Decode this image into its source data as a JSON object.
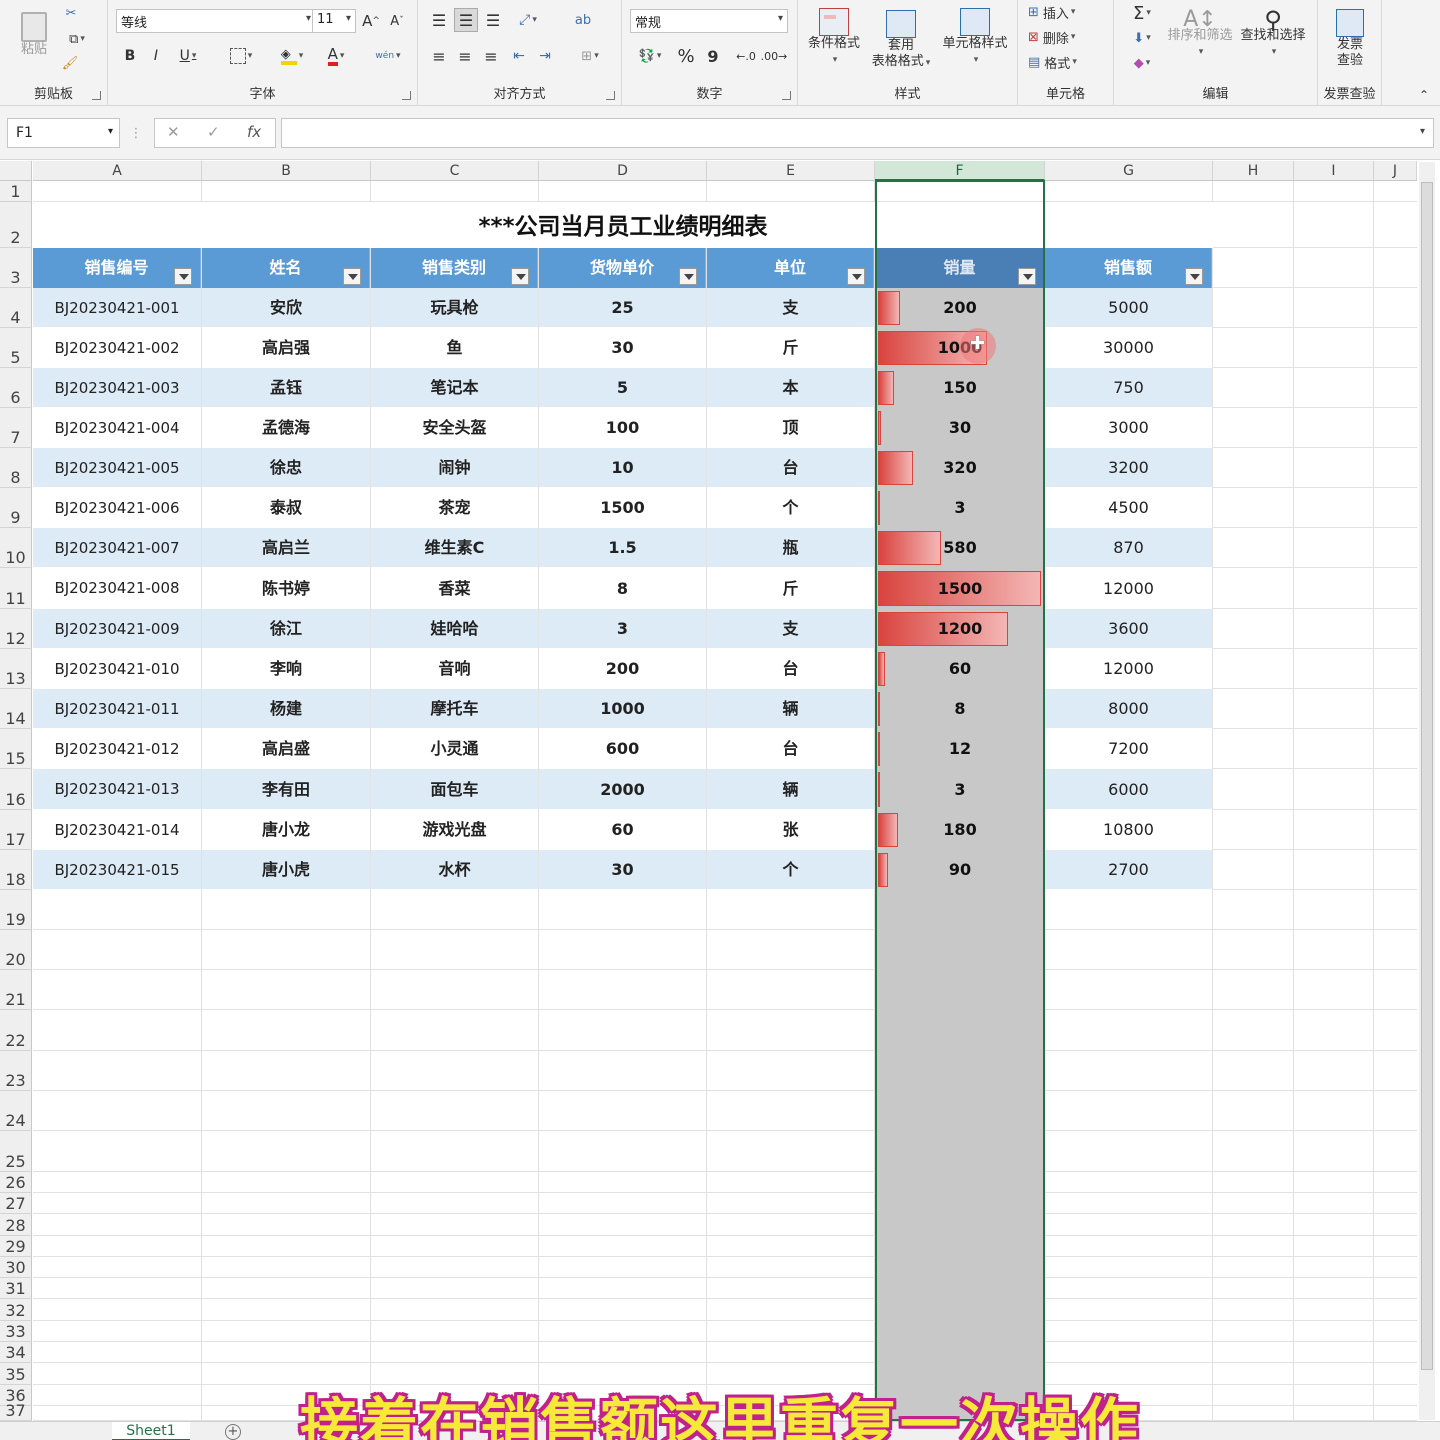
{
  "ribbon": {
    "clipboard": {
      "group": "剪贴板",
      "paste": "粘贴"
    },
    "font": {
      "group": "字体",
      "family": "等线",
      "size": "11",
      "bold": "B",
      "italic": "I",
      "underline": "U",
      "grow": "A^",
      "shrink": "Aˇ",
      "phonetic": "wén"
    },
    "align": {
      "group": "对齐方式",
      "wrap": "ab"
    },
    "number": {
      "group": "数字",
      "format": "常规",
      "percent": "%",
      "comma": "9"
    },
    "styles": {
      "group": "样式",
      "conditional": "条件格式",
      "table_line1": "套用",
      "table_line2": "表格格式",
      "cell_styles": "单元格样式"
    },
    "cells": {
      "group": "单元格",
      "insert": "插入",
      "delete": "删除",
      "format": "格式"
    },
    "editing": {
      "group": "编辑",
      "sigma": "Σ",
      "sort": "排序和筛选",
      "find": "查找和选择"
    },
    "invoice": {
      "group": "发票查验",
      "btn_line1": "发票",
      "btn_line2": "查验"
    }
  },
  "formula_bar": {
    "name_box": "F1",
    "cancel": "✕",
    "confirm": "✓",
    "fx": "fx",
    "content": ""
  },
  "columns": [
    "A",
    "B",
    "C",
    "D",
    "E",
    "F",
    "G",
    "H",
    "I",
    "J"
  ],
  "rows": [
    "1",
    "2",
    "3",
    "4",
    "5",
    "6",
    "7",
    "8",
    "9",
    "10",
    "11",
    "12",
    "13",
    "14",
    "15",
    "16",
    "17",
    "18",
    "19",
    "20",
    "21",
    "22",
    "23",
    "24",
    "25",
    "26",
    "27",
    "28",
    "29",
    "30",
    "31",
    "32",
    "33",
    "34",
    "35",
    "36",
    "37"
  ],
  "sheet": {
    "title": "***公司当月员工业绩明细表",
    "headers": [
      "销售编号",
      "姓名",
      "销售类别",
      "货物单价",
      "单位",
      "销量",
      "销售额"
    ],
    "records": [
      [
        "BJ20230421-001",
        "安欣",
        "玩具枪",
        "25",
        "支",
        "200",
        "5000"
      ],
      [
        "BJ20230421-002",
        "高启强",
        "鱼",
        "30",
        "斤",
        "1000",
        "30000"
      ],
      [
        "BJ20230421-003",
        "孟钰",
        "笔记本",
        "5",
        "本",
        "150",
        "750"
      ],
      [
        "BJ20230421-004",
        "孟德海",
        "安全头盔",
        "100",
        "顶",
        "30",
        "3000"
      ],
      [
        "BJ20230421-005",
        "徐忠",
        "闹钟",
        "10",
        "台",
        "320",
        "3200"
      ],
      [
        "BJ20230421-006",
        "泰叔",
        "茶宠",
        "1500",
        "个",
        "3",
        "4500"
      ],
      [
        "BJ20230421-007",
        "高启兰",
        "维生素C",
        "1.5",
        "瓶",
        "580",
        "870"
      ],
      [
        "BJ20230421-008",
        "陈书婷",
        "香菜",
        "8",
        "斤",
        "1500",
        "12000"
      ],
      [
        "BJ20230421-009",
        "徐江",
        "娃哈哈",
        "3",
        "支",
        "1200",
        "3600"
      ],
      [
        "BJ20230421-010",
        "李响",
        "音响",
        "200",
        "台",
        "60",
        "12000"
      ],
      [
        "BJ20230421-011",
        "杨建",
        "摩托车",
        "1000",
        "辆",
        "8",
        "8000"
      ],
      [
        "BJ20230421-012",
        "高启盛",
        "小灵通",
        "600",
        "台",
        "12",
        "7200"
      ],
      [
        "BJ20230421-013",
        "李有田",
        "面包车",
        "2000",
        "辆",
        "3",
        "6000"
      ],
      [
        "BJ20230421-014",
        "唐小龙",
        "游戏光盘",
        "60",
        "张",
        "180",
        "10800"
      ],
      [
        "BJ20230421-015",
        "唐小虎",
        "水杯",
        "30",
        "个",
        "90",
        "2700"
      ]
    ],
    "databar_max": 1500
  },
  "sheet_tab": "Sheet1",
  "subtitle": "接着在销售额这里重复一次操作",
  "colors": {
    "header_blue": "#5b9bd5",
    "band_blue": "#ddebf7",
    "databar_red": "#d9443f",
    "select_green": "#217346",
    "subtitle_yellow": "#f7e93a",
    "subtitle_outline": "#c0218b"
  }
}
